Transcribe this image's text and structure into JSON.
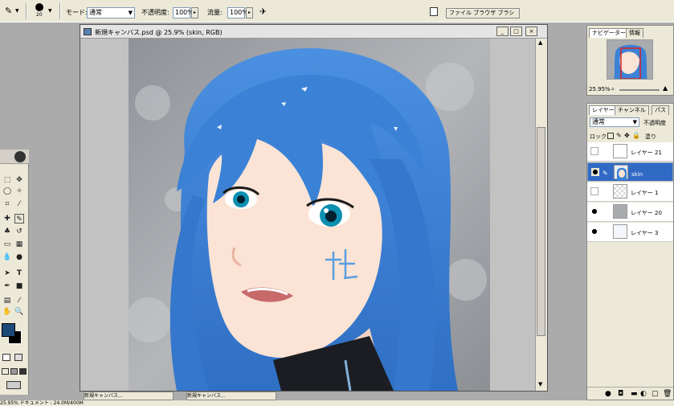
{
  "options_bar": {
    "mode_label": "モード:",
    "mode_value": "通常",
    "opacity_label": "不透明度:",
    "opacity_value": "100%",
    "flow_label": "流量:",
    "flow_value": "100%",
    "brush_size": "20",
    "palette_tab_label": "ファイル ブラウザ ブラシ"
  },
  "document": {
    "title": "新規キャンバス.psd @ 25.9% (skin, RGB)",
    "min_label": "_",
    "max_label": "□",
    "close_label": "×"
  },
  "navigator": {
    "tabs": [
      "ナビゲーター",
      "情報"
    ],
    "zoom": "25.95%"
  },
  "layers": {
    "tabs": [
      "レイヤー",
      "チャンネル",
      "パス"
    ],
    "blend_mode": "通常",
    "opacity_label": "不透明度",
    "lock_label": "ロック",
    "fill_label": "塗り",
    "rows": [
      {
        "name": "レイヤー 21",
        "visible": false,
        "selected": false
      },
      {
        "name": "skin",
        "visible": true,
        "selected": true
      },
      {
        "name": "レイヤー 1",
        "visible": false,
        "selected": false
      },
      {
        "name": "レイヤー 20",
        "visible": true,
        "selected": false
      },
      {
        "name": "レイヤー 3",
        "visible": true,
        "selected": false
      }
    ]
  },
  "minimized_windows": [
    "新規キャンバス...",
    "新規キャンバス..."
  ],
  "status_text": "25.95%  ドキュメント : 24.0M/400M",
  "colors": {
    "foreground": "#1d4a78",
    "background": "#000000",
    "hair": "#3f86d8",
    "skin": "#fbe4d5"
  }
}
